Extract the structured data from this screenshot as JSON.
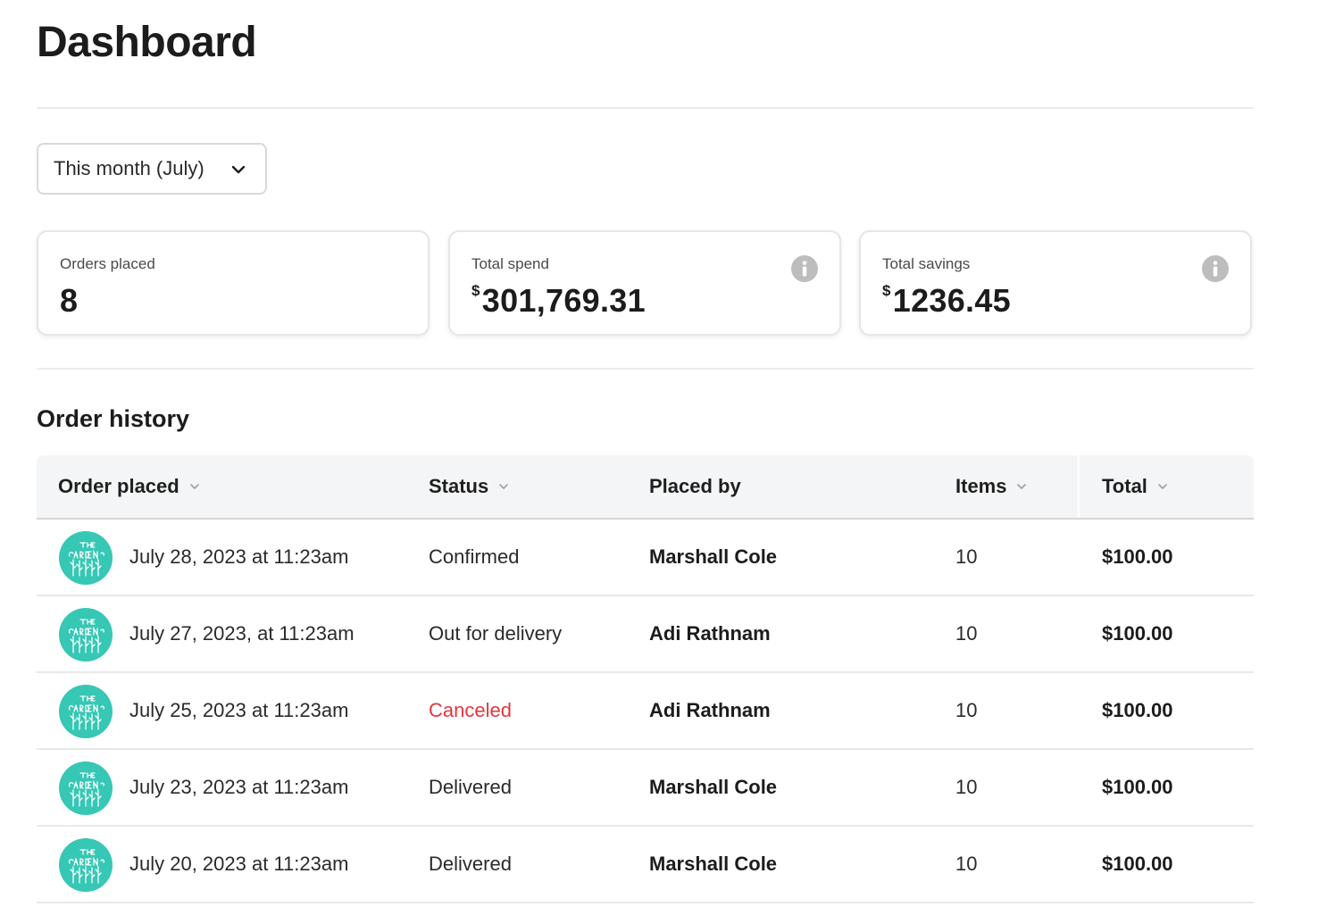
{
  "page": {
    "title": "Dashboard"
  },
  "filter": {
    "selected": "This month (July)"
  },
  "stats": [
    {
      "label": "Orders placed",
      "currency": "",
      "value": "8"
    },
    {
      "label": "Total spend",
      "currency": "$",
      "value": "301,769.31"
    },
    {
      "label": "Total savings",
      "currency": "$",
      "value": "1236.45"
    }
  ],
  "order_history": {
    "title": "Order history",
    "columns": [
      "Order placed",
      "Status",
      "Placed by",
      "Items",
      "Total"
    ],
    "rows": [
      {
        "date": "July 28, 2023 at 11:23am",
        "status": "Confirmed",
        "placed_by": "Marshall Cole",
        "items": "10",
        "total": "$100.00"
      },
      {
        "date": "July 27, 2023, at 11:23am",
        "status": "Out for delivery",
        "placed_by": "Adi Rathnam",
        "items": "10",
        "total": "$100.00"
      },
      {
        "date": "July 25, 2023 at 11:23am",
        "status": "Canceled",
        "placed_by": "Adi Rathnam",
        "items": "10",
        "total": "$100.00"
      },
      {
        "date": "July 23, 2023 at 11:23am",
        "status": "Delivered",
        "placed_by": "Marshall Cole",
        "items": "10",
        "total": "$100.00"
      },
      {
        "date": "July 20, 2023 at 11:23am",
        "status": "Delivered",
        "placed_by": "Marshall Cole",
        "items": "10",
        "total": "$100.00"
      }
    ]
  },
  "icons": {
    "dropdown": "chevron-down-icon",
    "info": "info-icon",
    "sort": "chevron-down-icon",
    "avatar": "garden-logo"
  },
  "colors": {
    "canceled": "#e0383e",
    "avatar_bg": "#36c7b5",
    "header_bg": "#f4f5f6"
  }
}
